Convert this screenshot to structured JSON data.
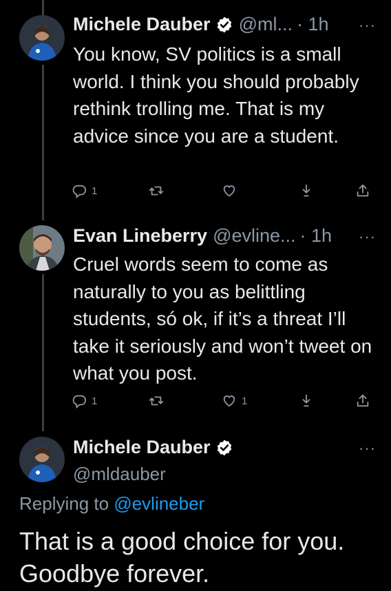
{
  "tweets": [
    {
      "name": "Michele Dauber",
      "handle": "@ml...",
      "time": "· 1h",
      "text": "You know, SV politics is a small world. I think you should probably rethink trolling me. That is my advice since you are a student.",
      "reply_count": "1",
      "retweet_count": "",
      "like_count": ""
    },
    {
      "name": "Evan Lineberry",
      "handle": "@evline...",
      "time": "· 1h",
      "text": "Cruel words seem to come as naturally to you as belittling students, só ok, if it’s a threat I’ll take it seriously and won’t tweet on what you post.",
      "reply_count": "1",
      "retweet_count": "",
      "like_count": "1"
    }
  ],
  "main_tweet": {
    "name": "Michele Dauber",
    "handle": "@mldauber",
    "replying_prefix": "Replying to",
    "replying_to": "@evlineber",
    "text": "That is a good choice for you. Goodbye forever."
  },
  "more_label": "···",
  "colors": {
    "background": "#000000",
    "text": "#e7e9ea",
    "secondary": "#8b98a5",
    "link": "#1d9bf0",
    "verified_badge": "#ffffff"
  },
  "icons": [
    "reply-icon",
    "retweet-icon",
    "like-icon",
    "share-icon",
    "export-icon",
    "verified-icon",
    "more-icon"
  ]
}
